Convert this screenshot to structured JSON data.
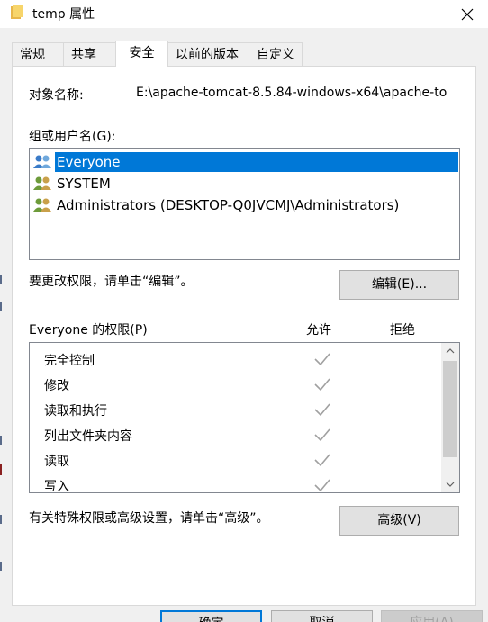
{
  "window": {
    "title": "temp 属性",
    "close_icon": "close-icon"
  },
  "tabs": [
    {
      "label": "常规"
    },
    {
      "label": "共享"
    },
    {
      "label": "安全",
      "active": true
    },
    {
      "label": "以前的版本"
    },
    {
      "label": "自定义"
    }
  ],
  "security": {
    "object_name_label": "对象名称:",
    "object_name_value": "E:\\apache-tomcat-8.5.84-windows-x64\\apache-to",
    "group_label": "组或用户名(G):",
    "users": [
      {
        "name": "Everyone",
        "selected": true
      },
      {
        "name": "SYSTEM"
      },
      {
        "name": "Administrators (DESKTOP-Q0JVCMJ\\Administrators)"
      }
    ],
    "edit_hint": "要更改权限，请单击“编辑”。",
    "edit_button": "编辑(E)...",
    "permissions_label": "Everyone 的权限(P)",
    "allow_header": "允许",
    "deny_header": "拒绝",
    "permissions": [
      {
        "name": "完全控制",
        "allow": true
      },
      {
        "name": "修改",
        "allow": true
      },
      {
        "name": "读取和执行",
        "allow": true
      },
      {
        "name": "列出文件夹内容",
        "allow": true
      },
      {
        "name": "读取",
        "allow": true
      },
      {
        "name": "写入",
        "allow": true
      }
    ],
    "advanced_hint": "有关特殊权限或高级设置，请单击“高级”。",
    "advanced_button": "高级(V)"
  },
  "footer": {
    "ok_button": "确定",
    "cancel_button": "取消",
    "apply_button": "应用(A)"
  },
  "colors": {
    "selection": "#0078d7",
    "check_gray": "#a0a0a0"
  }
}
